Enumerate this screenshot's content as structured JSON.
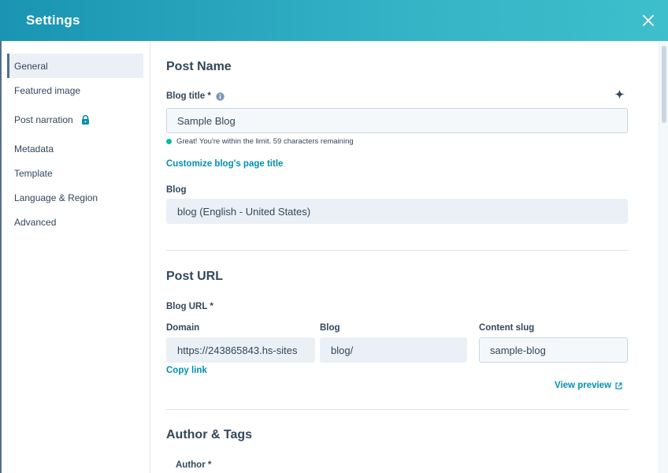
{
  "header": {
    "title": "Settings"
  },
  "sidebar": {
    "items": [
      {
        "label": "General"
      },
      {
        "label": "Featured image"
      },
      {
        "label": "Post narration"
      },
      {
        "label": "Metadata"
      },
      {
        "label": "Template"
      },
      {
        "label": "Language & Region"
      },
      {
        "label": "Advanced"
      }
    ]
  },
  "post_name": {
    "title": "Post Name",
    "blog_title_label": "Blog title *",
    "blog_title_value": "Sample Blog",
    "hint": "Great! You're within the limit. 59 characters remaining",
    "customize_link": "Customize blog's page title",
    "blog_label": "Blog",
    "blog_value": "blog (English - United States)"
  },
  "post_url": {
    "title": "Post URL",
    "blog_url_label": "Blog URL *",
    "domain_label": "Domain",
    "domain_value": "https://243865843.hs-sites",
    "blog_label": "Blog",
    "blog_value": "blog/",
    "slug_label": "Content slug",
    "slug_value": "sample-blog",
    "copy_link": "Copy link",
    "view_preview": "View preview"
  },
  "author_tags": {
    "title": "Author & Tags",
    "author_label": "Author *"
  },
  "colors": {
    "accent": "#0091ae",
    "header": "#1a94b2",
    "success": "#00bda5"
  }
}
